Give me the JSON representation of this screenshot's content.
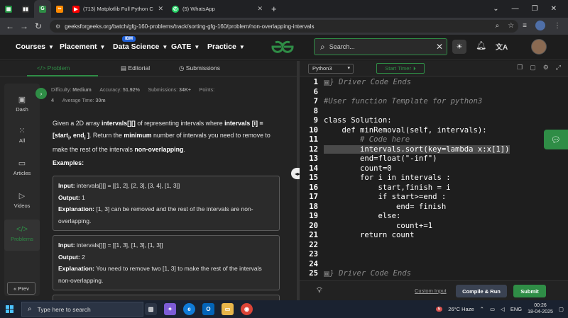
{
  "browser": {
    "tabs": [
      {
        "kind": "sheets",
        "title": "",
        "active": false
      },
      {
        "kind": "media",
        "title": "",
        "active": false
      },
      {
        "kind": "gfg",
        "title": "",
        "active": true
      },
      {
        "kind": "other",
        "title": "",
        "active": false
      },
      {
        "kind": "youtube",
        "title": "(713) Matplotlib Full Python Co",
        "active": false
      },
      {
        "kind": "whatsapp",
        "title": "(5) WhatsApp",
        "active": false
      }
    ],
    "url": "geeksforgeeks.org/batch/gfg-160-problems/track/sorting-gfg-160/problem/non-overlapping-intervals"
  },
  "nav": {
    "items": [
      "Courses",
      "Placement",
      "Data Science",
      "GATE",
      "Practice"
    ],
    "badge": "IBM",
    "search_placeholder": "Search..."
  },
  "problem_tabs": [
    "Problem",
    "Editorial",
    "Submissions"
  ],
  "sidebar": [
    "Dash",
    "All",
    "Articles",
    "Videos",
    "Problems"
  ],
  "prev_label": "Prev",
  "meta": {
    "difficulty_label": "Difficulty:",
    "difficulty": "Medium",
    "accuracy_label": "Accuracy:",
    "accuracy": "51.92%",
    "submissions_label": "Submissions:",
    "submissions": "34K+",
    "points_label": "Points:",
    "points": "4",
    "avg_time_label": "Average Time:",
    "avg_time": "30m"
  },
  "description": {
    "p1": "Given a 2D array",
    "p2": "intervals[][]",
    "p3": "of representing intervals where",
    "p4": "intervals [i] = [start",
    "p5": "i",
    "p6": ", end",
    "p7": "i",
    "p8": " ]",
    "p9": ". Return the",
    "p10": "minimum",
    "p11": "number of intervals you need to remove to make the rest of the intervals",
    "p12": "non-overlapping",
    "p13": "."
  },
  "examples_heading": "Examples:",
  "examples": [
    {
      "input_label": "Input:",
      "input": "intervals[][] = [[1, 2], [2, 3], [3, 4], [1, 3]]",
      "output_label": "Output:",
      "output": "1",
      "exp_label": "Explanation:",
      "exp": "[1, 3] can be removed and the rest of the intervals are non-overlapping."
    },
    {
      "input_label": "Input:",
      "input": "intervals[][] = [[1, 3], [1, 3], [1, 3]]",
      "output_label": "Output:",
      "output": "2",
      "exp_label": "Explanation:",
      "exp": "You need to remove two [1, 3] to make the rest of the intervals non-overlapping."
    }
  ],
  "editor": {
    "language": "Python3",
    "timer_label": "Start Timer",
    "lines": [
      {
        "n": "1",
        "t": "} Driver Code Ends"
      },
      {
        "n": "6",
        "t": ""
      },
      {
        "n": "7",
        "t": "#User function Template for python3"
      },
      {
        "n": "8",
        "t": ""
      },
      {
        "n": "9",
        "t": "class Solution:"
      },
      {
        "n": "10",
        "t": "    def minRemoval(self, intervals):"
      },
      {
        "n": "11",
        "t": "        # Code here"
      },
      {
        "n": "12",
        "t": "        intervals.sort(key=lambda x:x[1])"
      },
      {
        "n": "13",
        "t": "        end=float(\"-inf\")"
      },
      {
        "n": "14",
        "t": "        count=0"
      },
      {
        "n": "15",
        "t": "        for i in intervals :"
      },
      {
        "n": "16",
        "t": "            start,finish = i"
      },
      {
        "n": "17",
        "t": "            if start>=end :"
      },
      {
        "n": "18",
        "t": "                end= finish"
      },
      {
        "n": "19",
        "t": "            else:"
      },
      {
        "n": "20",
        "t": "                count+=1"
      },
      {
        "n": "21",
        "t": "        return count"
      },
      {
        "n": "22",
        "t": ""
      },
      {
        "n": "23",
        "t": ""
      },
      {
        "n": "24",
        "t": ""
      },
      {
        "n": "25",
        "t": "} Driver Code Ends"
      }
    ],
    "custom_input": "Custom Input",
    "compile_run": "Compile & Run",
    "submit": "Submit"
  },
  "taskbar": {
    "search_placeholder": "Type here to search",
    "badge": "5",
    "weather": "26°C  Haze",
    "lang": "ENG",
    "time": "00:26",
    "date": "18-04-2025"
  },
  "colors": {
    "gfg_green": "#2f8d46",
    "bg": "#1e1e1e"
  }
}
